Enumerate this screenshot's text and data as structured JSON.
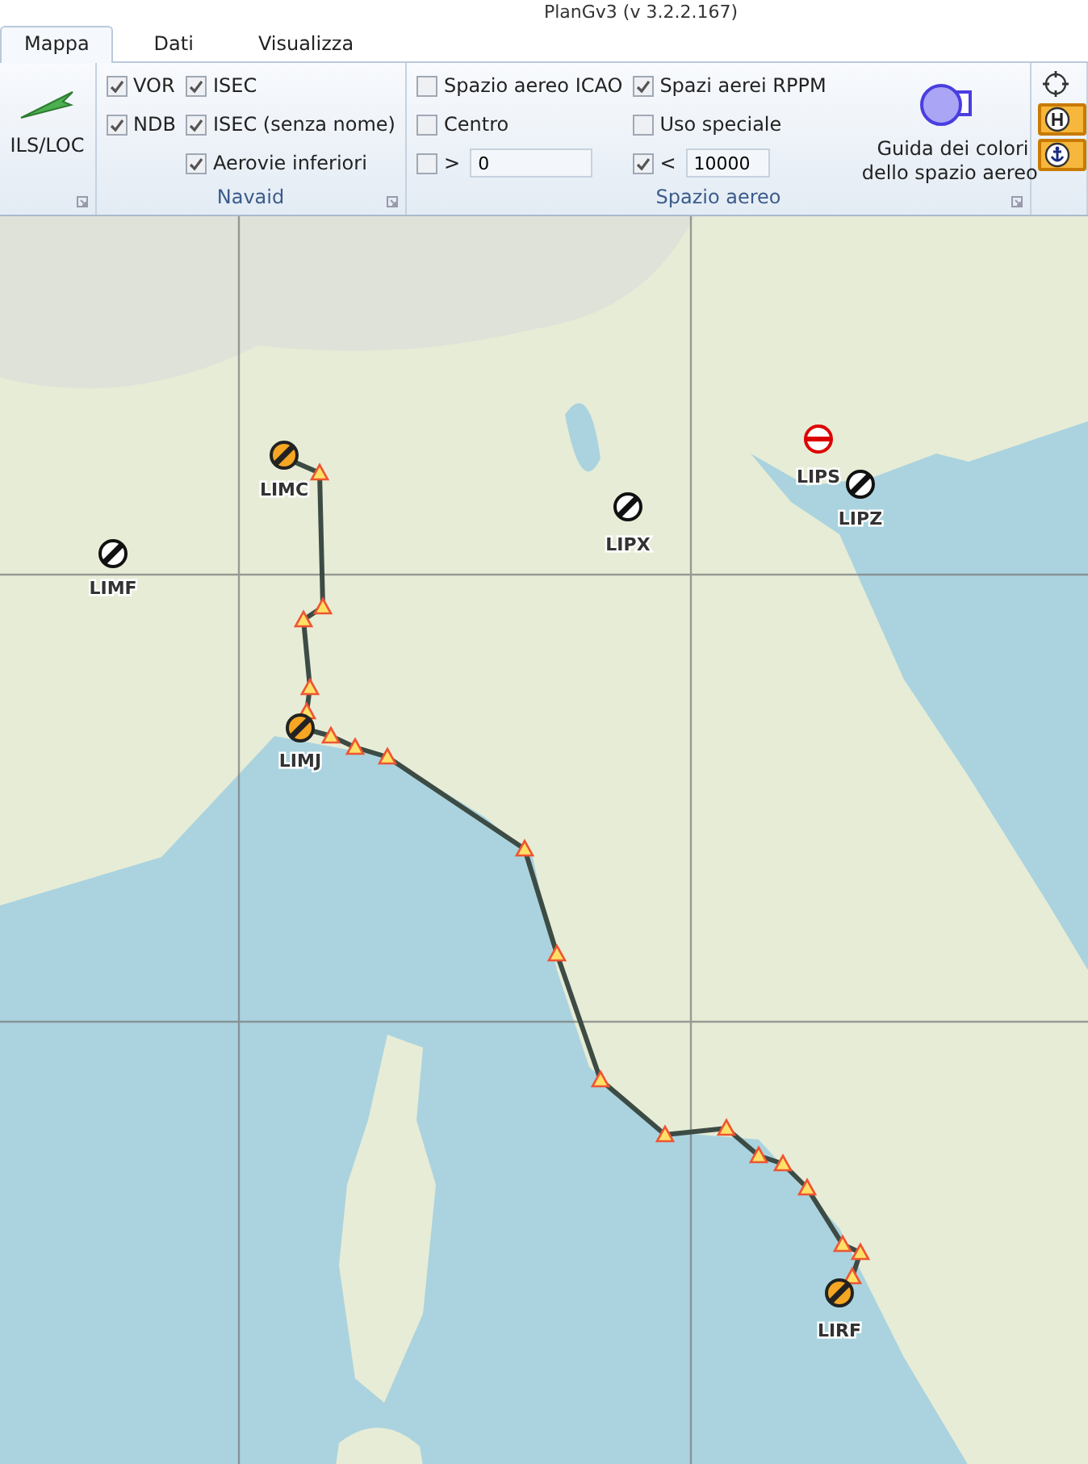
{
  "window": {
    "title": "PlanGv3 (v 3.2.2.167)"
  },
  "tabs": [
    {
      "label": "Mappa",
      "selected": true
    },
    {
      "label": "Dati",
      "selected": false
    },
    {
      "label": "Visualizza",
      "selected": false
    }
  ],
  "ribbon": {
    "ils_button": {
      "label": "ILS/LOC"
    },
    "navaid": {
      "label": "Navaid",
      "columns": [
        [
          {
            "label": "VOR",
            "checked": true
          },
          {
            "label": "NDB",
            "checked": true
          }
        ],
        [
          {
            "label": "ISEC",
            "checked": true
          },
          {
            "label": "ISEC (senza nome)",
            "checked": true
          },
          {
            "label": "Aerovie inferiori",
            "checked": true
          }
        ]
      ]
    },
    "airspace": {
      "label": "Spazio aereo",
      "columns": [
        [
          {
            "kind": "check",
            "label": "Spazio aereo ICAO",
            "checked": false
          },
          {
            "kind": "check",
            "label": "Centro",
            "checked": false
          },
          {
            "kind": "limit",
            "label": ">",
            "checked": false,
            "value": "0"
          }
        ],
        [
          {
            "kind": "check",
            "label": "Spazi aerei RPPM",
            "checked": true
          },
          {
            "kind": "check",
            "label": "Uso speciale",
            "checked": false
          },
          {
            "kind": "limit",
            "label": "<",
            "checked": true,
            "value": "10000"
          }
        ]
      ],
      "guide_button": {
        "label": "Guida dei colori\ndello spazio aereo"
      }
    },
    "side_toggles": [
      {
        "kind": "target",
        "selected": false
      },
      {
        "kind": "heliport",
        "selected": true
      },
      {
        "kind": "seaport",
        "selected": true
      }
    ]
  },
  "map": {
    "airports": [
      {
        "code": "LIMC",
        "kind": "route"
      },
      {
        "code": "LIMJ",
        "kind": "route"
      },
      {
        "code": "LIMF",
        "kind": "plain"
      },
      {
        "code": "LIPX",
        "kind": "plain"
      },
      {
        "code": "LIPS",
        "kind": "closed"
      },
      {
        "code": "LIPZ",
        "kind": "plain"
      },
      {
        "code": "LIRF",
        "kind": "route"
      }
    ]
  }
}
